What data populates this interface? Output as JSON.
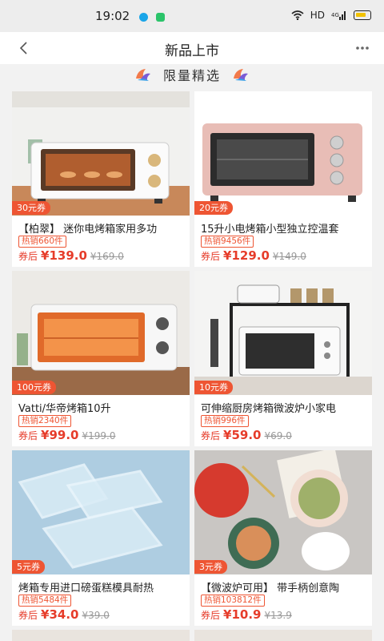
{
  "status_bar": {
    "time": "19:02",
    "network": "HD",
    "signal": "4G"
  },
  "header": {
    "title": "新品上市",
    "back_icon": "chevron-left-icon",
    "more_icon": "more-dots-icon"
  },
  "section": {
    "title": "限量精选"
  },
  "products": [
    {
      "coupon": "30元券",
      "title": "【柏翠】 迷你电烤箱家用多功",
      "sold": "热销660件",
      "price_tag": "券后",
      "price": "¥139.0",
      "original_price": "¥169.0"
    },
    {
      "coupon": "20元券",
      "title": "15升小电烤箱小型独立控温套",
      "sold": "热销9456件",
      "price_tag": "券后",
      "price": "¥129.0",
      "original_price": "¥149.0"
    },
    {
      "coupon": "100元券",
      "title": "Vatti/华帝烤箱10升",
      "sold": "热销2340件",
      "price_tag": "券后",
      "price": "¥99.0",
      "original_price": "¥199.0"
    },
    {
      "coupon": "10元券",
      "title": "可伸缩厨房烤箱微波炉小家电",
      "sold": "热销996件",
      "price_tag": "券后",
      "price": "¥59.0",
      "original_price": "¥69.0"
    },
    {
      "coupon": "5元券",
      "title": "烤箱专用进口磅蛋糕模具耐热",
      "sold": "热销5484件",
      "price_tag": "券后",
      "price": "¥34.0",
      "original_price": "¥39.0"
    },
    {
      "coupon": "3元券",
      "title": "【微波炉可用】 带手柄创意陶",
      "sold": "热销103812件",
      "price_tag": "券后",
      "price": "¥10.9",
      "original_price": "¥13.9"
    }
  ],
  "colors": {
    "accent": "#e63c2a",
    "coupon_bg": "#ee5533"
  }
}
